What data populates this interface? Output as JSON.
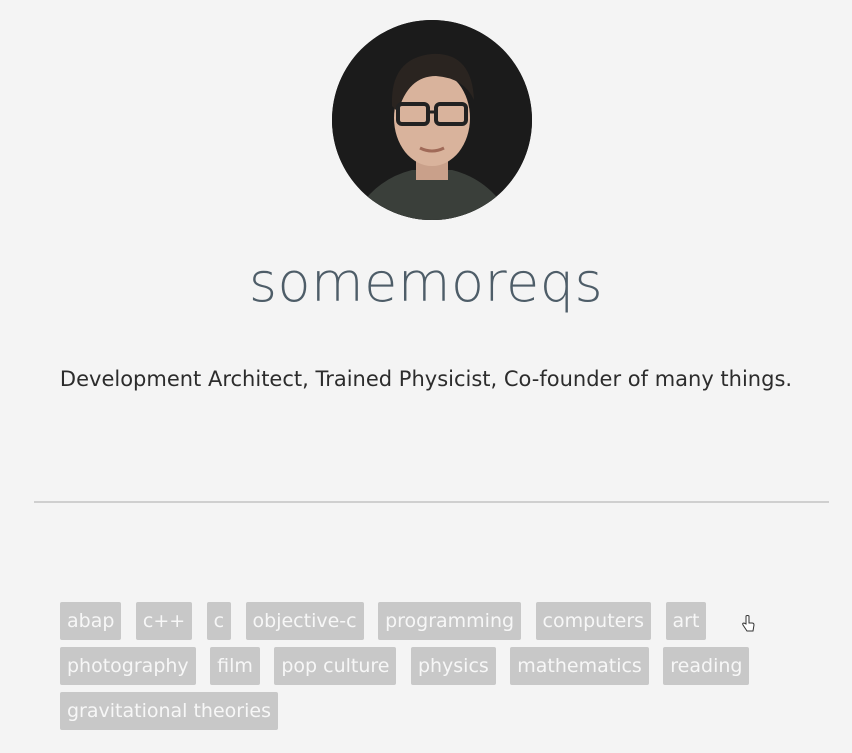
{
  "profile": {
    "avatar_icon": "profile-photo",
    "username": "somemoreqs",
    "bio": "Development Architect, Trained Physicist, Co-founder of many things."
  },
  "tags": [
    "abap",
    "c++",
    "c",
    "objective-c",
    "programming",
    "computers",
    "art",
    "photography",
    "film",
    "pop culture",
    "physics",
    "mathematics",
    "reading",
    "gravitational theories"
  ],
  "colors": {
    "background": "#f4f4f4",
    "username": "#4e5d68",
    "tag_background": "#c8c8c8",
    "tag_text": "#f7f7f7",
    "divider": "#cfcfcf"
  },
  "cursor_icon": "hand-pointer-icon"
}
